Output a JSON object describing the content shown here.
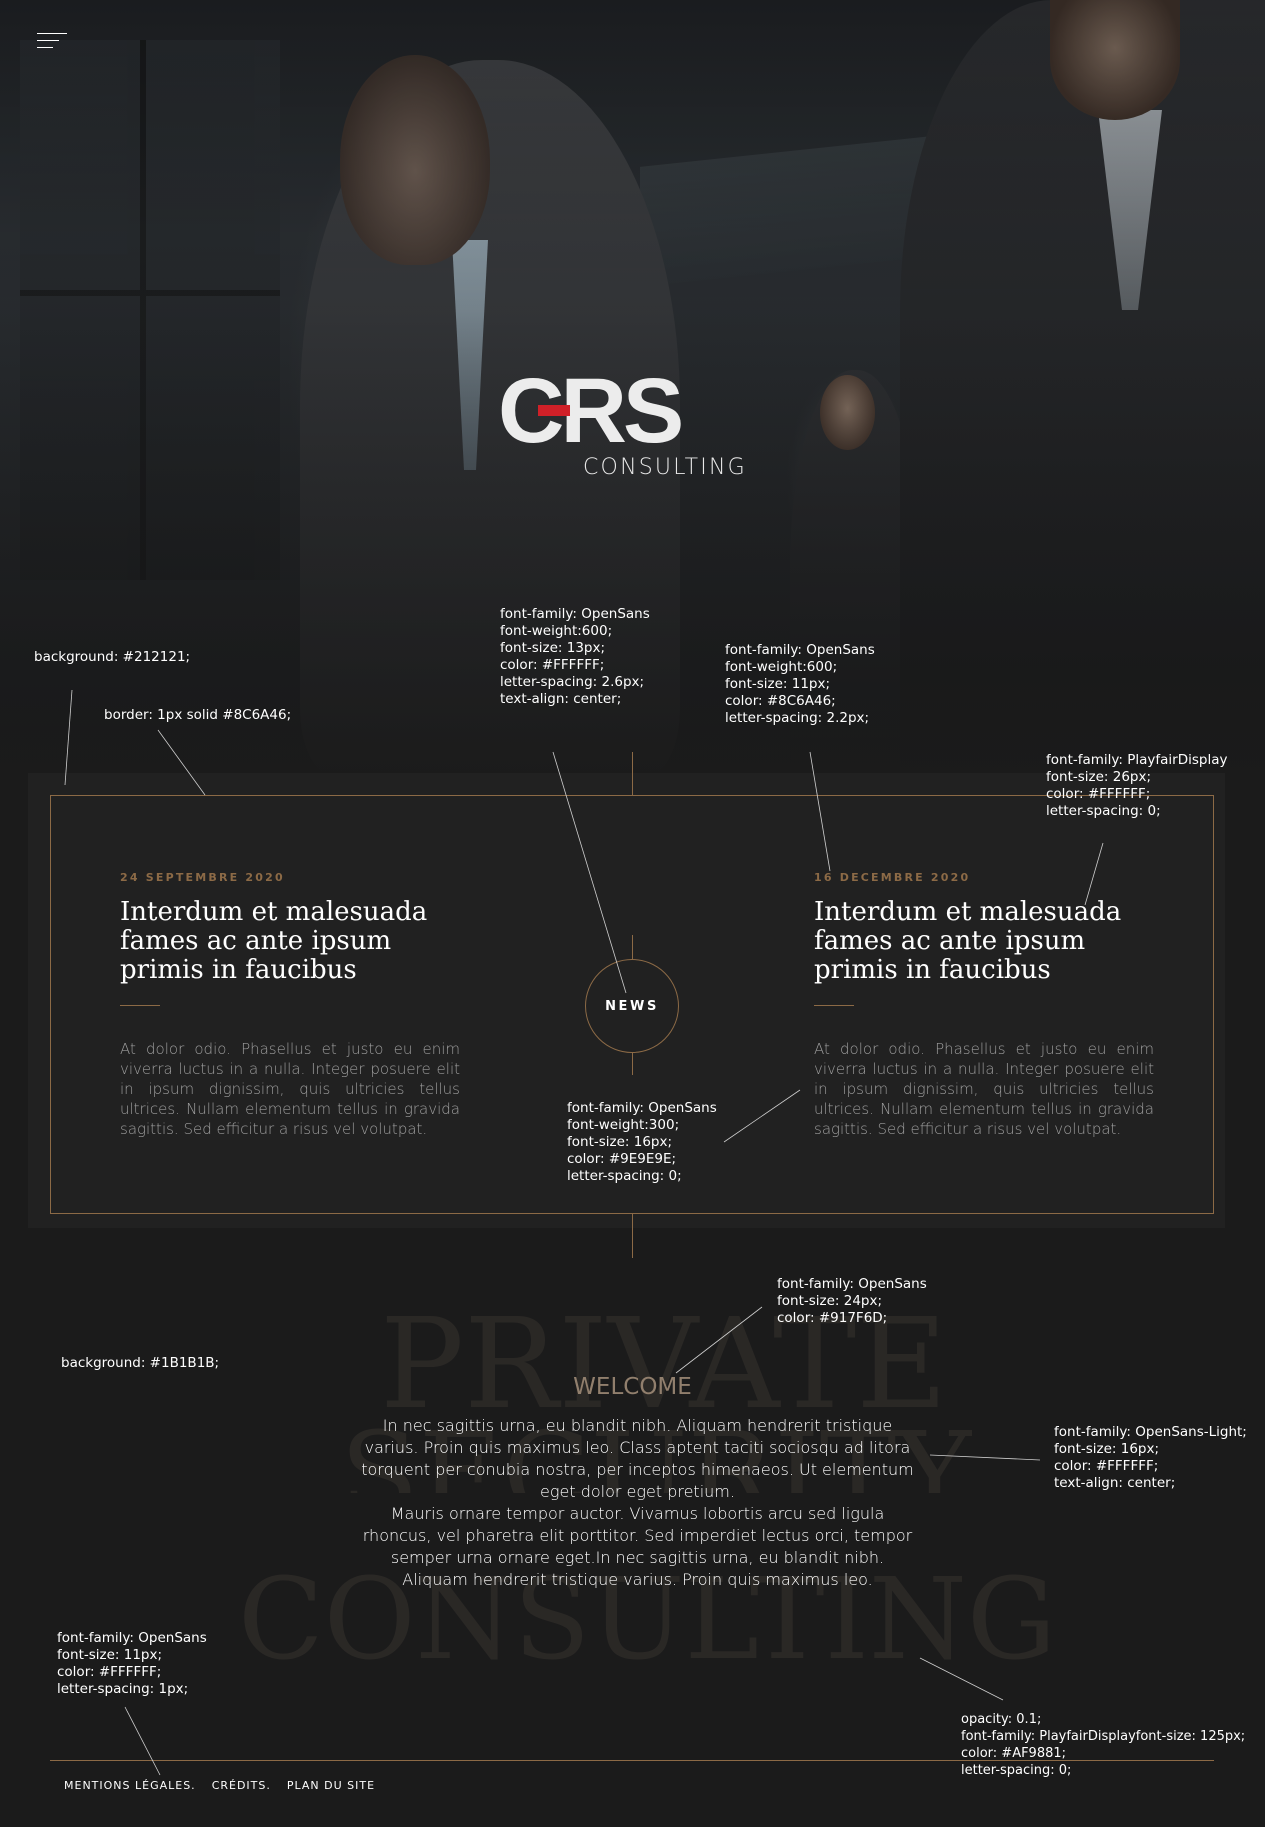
{
  "brand": {
    "mark": "CRS",
    "sub": "CONSULTING",
    "accent": "#d02028"
  },
  "menu": {
    "icon": "hamburger-menu-icon"
  },
  "news": {
    "label": "NEWS",
    "articles": [
      {
        "date": "24 SEPTEMBRE 2020",
        "title": "Interdum et malesuada fames ac ante ipsum primis in faucibus",
        "body": "At dolor odio. Phasellus et justo eu enim viverra luctus in a nulla. Integer posuere elit in ipsum dignissim, quis ultricies tellus ultrices. Nullam elementum tellus in gravida sagittis. Sed efficitur a risus vel volutpat."
      },
      {
        "date": "16 DECEMBRE 2020",
        "title": "Interdum et malesuada fames ac ante ipsum primis in faucibus",
        "body": "At dolor odio. Phasellus et justo eu enim viverra luctus in a nulla. Integer posuere elit in ipsum dignissim, quis ultricies tellus ultrices. Nullam elementum tellus in gravida sagittis. Sed efficitur a risus vel volutpat."
      }
    ]
  },
  "intro": {
    "bg_words": [
      "PRIVATE",
      "SECURITY",
      "CONSULTING"
    ],
    "welcome": "WELCOME",
    "paragraph1": "In nec sagittis urna, eu blandit nibh. Aliquam hendrerit tristique varius. Proin quis maximus leo. Class aptent taciti sociosqu ad litora torquent per conubia nostra, per inceptos himenaeos. Ut elementum eget dolor eget pretium.",
    "paragraph2": "Mauris ornare tempor auctor. Vivamus lobortis arcu sed ligula rhoncus, vel pharetra elit porttitor. Sed imperdiet lectus orci, tempor semper urna ornare eget.In nec sagittis urna, eu blandit nibh. Aliquam hendrerit tristique varius. Proin quis maximus leo."
  },
  "footer": {
    "links": [
      "MENTIONS LÉGALES.",
      "CRÉDITS.",
      "PLAN DU SITE"
    ]
  },
  "annotations": {
    "news_bg": "background: #212121;",
    "news_border": "border: 1px solid #8C6A46;",
    "news_label": "font-family: OpenSans\nfont-weight:600;\nfont-size: 13px;\ncolor: #FFFFFF;\nletter-spacing: 2.6px;\ntext-align: center;",
    "date": "font-family: OpenSans\nfont-weight:600;\nfont-size: 11px;\ncolor: #8C6A46;\nletter-spacing: 2.2px;",
    "title": "font-family: PlayfairDisplay\nfont-size: 26px;\ncolor: #FFFFFF;\nletter-spacing: 0;",
    "body": "font-family: OpenSans\nfont-weight:300;\nfont-size: 16px;\ncolor: #9E9E9E;\nletter-spacing: 0;",
    "section_bg": "background: #1B1B1B;",
    "welcome": "font-family: OpenSans\nfont-size: 24px;\ncolor: #917F6D;",
    "paragraph": "font-family: OpenSans-Light;\nfont-size: 16px;\ncolor: #FFFFFF;\ntext-align: center;",
    "footer": "font-family: OpenSans\nfont-size: 11px;\ncolor: #FFFFFF;\nletter-spacing: 1px;",
    "bg_word": "opacity: 0.1;\nfont-family: PlayfairDisplayfont-size: 125px;\ncolor: #AF9881;\nletter-spacing: 0;"
  },
  "colors": {
    "gold": "#8C6A46",
    "section": "#1B1B1B",
    "card": "#212121",
    "welcome": "#917F6D"
  }
}
